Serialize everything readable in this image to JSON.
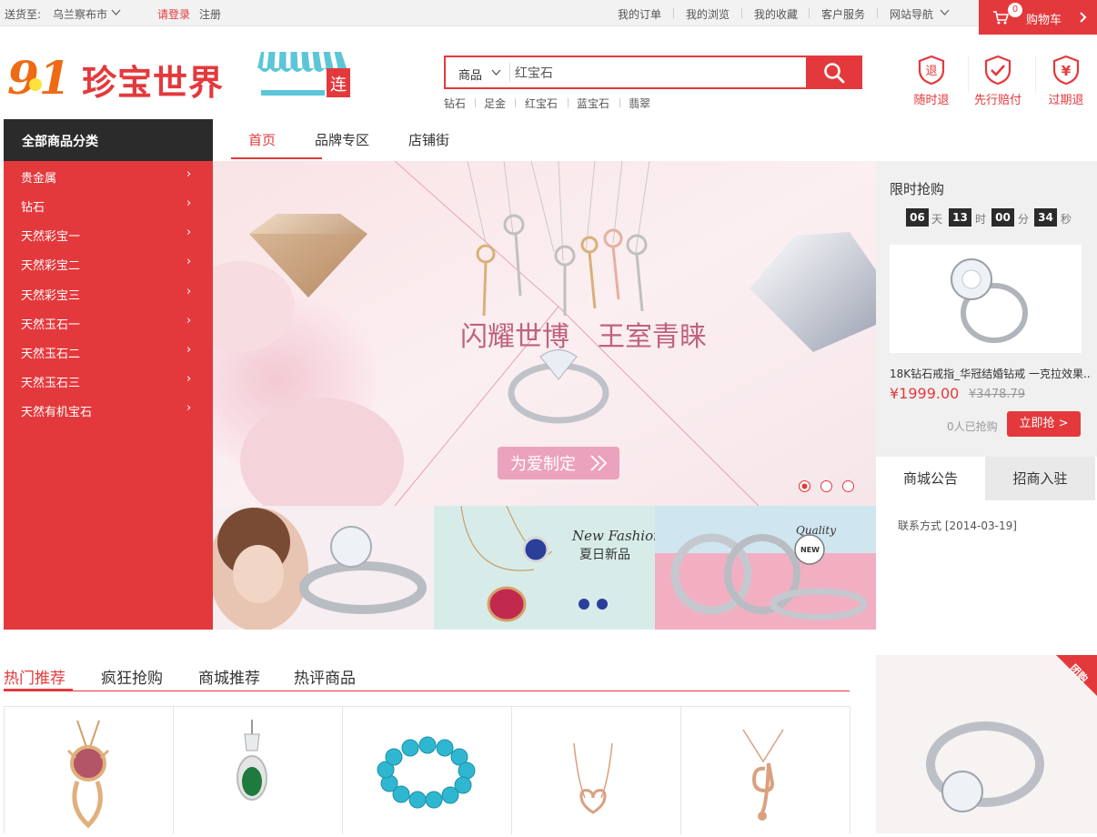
{
  "topbar": {
    "ship_label": "送货至:",
    "city": "乌兰察布市",
    "login": "请登录",
    "register": "注册",
    "links": [
      "我的订单",
      "我的浏览",
      "我的收藏",
      "客户服务",
      "网站导航"
    ],
    "cart_label": "购物车",
    "cart_count": "0"
  },
  "logo": {
    "number": "91",
    "text": "珍宝世界",
    "badge": "连"
  },
  "search": {
    "category": "商品",
    "value": "红宝石",
    "hotwords": [
      "钻石",
      "足金",
      "红宝石",
      "蓝宝石",
      "翡翠"
    ]
  },
  "promises": [
    "随时退",
    "先行赔付",
    "过期退"
  ],
  "nav": {
    "all_categories": "全部商品分类",
    "tabs": [
      "首页",
      "品牌专区",
      "店铺街"
    ],
    "categories": [
      "贵金属",
      "钻石",
      "天然彩宝一",
      "天然彩宝二",
      "天然彩宝三",
      "天然玉石一",
      "天然玉石二",
      "天然玉石三",
      "天然有机宝石"
    ]
  },
  "banner": {
    "left_text": "闪耀世博",
    "right_text": "王室青睐",
    "button": "为爱制定"
  },
  "subbanners": {
    "fashion_title": "New Fashion",
    "fashion_sub": "夏日新品",
    "quality": "Quality",
    "new": "NEW"
  },
  "flash_sale": {
    "title": "限时抢购",
    "countdown": [
      {
        "value": "06",
        "unit": "天"
      },
      {
        "value": "13",
        "unit": "时"
      },
      {
        "value": "00",
        "unit": "分"
      },
      {
        "value": "34",
        "unit": "秒"
      }
    ],
    "product_name": "18K钻石戒指_华冠结婚钻戒 一克拉效果...",
    "price": "¥1999.00",
    "old_price": "¥3478.79",
    "sold": "0人已抢购",
    "buy_button": "立即抢 >"
  },
  "notice": {
    "tabs": [
      "商城公告",
      "招商入驻"
    ],
    "items": [
      "联系方式 [2014-03-19]"
    ]
  },
  "section_tabs": [
    "热门推荐",
    "疯狂抢购",
    "商城推荐",
    "热评商品"
  ],
  "promo_badge": "团购",
  "colors": {
    "accent": "#e4393c",
    "dark": "#2b2b2b",
    "logo_orange": "#ee6a14"
  }
}
